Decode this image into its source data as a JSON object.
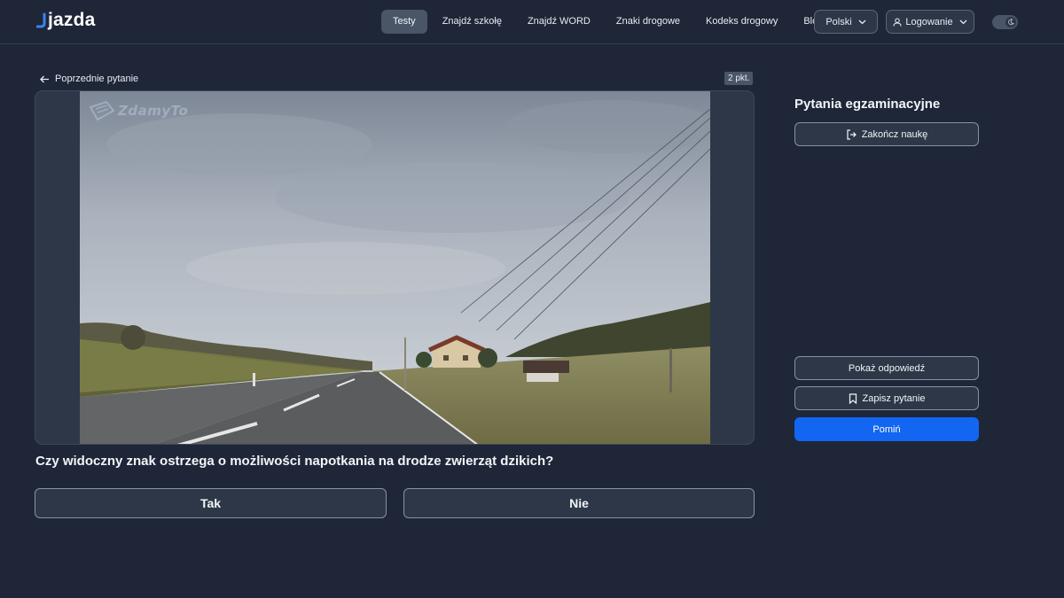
{
  "brand": {
    "name": "jazda"
  },
  "nav": {
    "items": [
      "Testy",
      "Znajdź szkołę",
      "Znajdź WORD",
      "Znaki drogowe",
      "Kodeks drogowy",
      "Blog"
    ],
    "active_index": 0
  },
  "header": {
    "language_label": "Polski",
    "login_label": "Logowanie"
  },
  "question_panel": {
    "back_label": "Poprzednie pytanie",
    "points_label": "2 pkt.",
    "watermark_text": "ZdamyTo",
    "question_text": "Czy widoczny znak ostrzega o możliwości napotkania na drodze zwierząt dzikich?",
    "answers": [
      "Tak",
      "Nie"
    ]
  },
  "sidebar": {
    "title": "Pytania egzaminacyjne",
    "end_label": "Zakończ naukę",
    "show_answer_label": "Pokaż odpowiedź",
    "save_question_label": "Zapisz pytanie",
    "skip_label": "Pomiń"
  },
  "colors": {
    "background": "#1e2637",
    "surface": "#2d3748",
    "accent": "#1266f1",
    "active_nav": "#4a5568"
  },
  "icons": [
    "arrow-left-icon",
    "chevron-down-icon",
    "user-icon",
    "moon-icon",
    "exit-icon",
    "bookmark-icon"
  ]
}
